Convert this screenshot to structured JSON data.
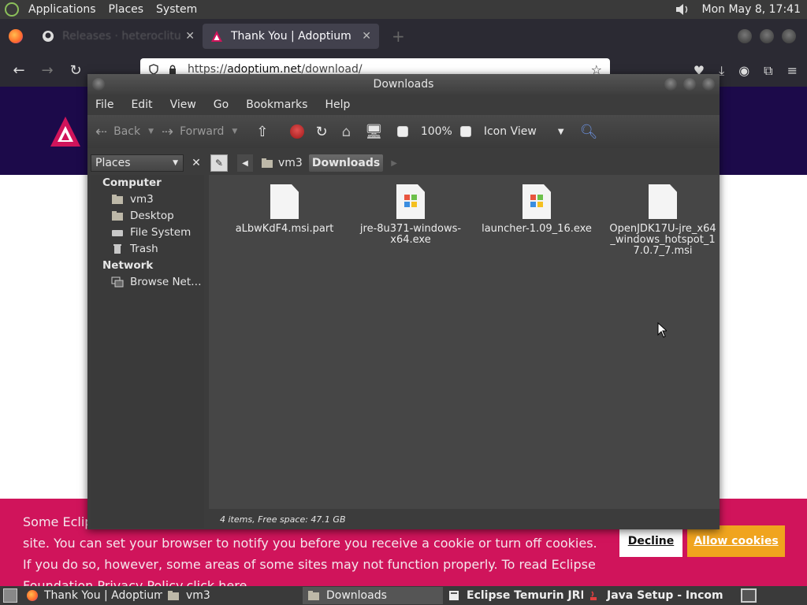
{
  "top_panel": {
    "menus": [
      "Applications",
      "Places",
      "System"
    ],
    "clock": "Mon May  8, 17:41"
  },
  "firefox": {
    "tabs": [
      {
        "label": "Releases · heteroclitus/..",
        "active": false
      },
      {
        "label": "Thank You | Adoptium",
        "active": true
      }
    ],
    "url_prefix": "https://",
    "url_domain": "adoptium.net",
    "url_path": "/download/"
  },
  "page": {
    "cookie_text": "Some Eclipse Foundation pages use cookies to better serve you when you return to the site. You can set your browser to notify you before you receive a cookie or turn off cookies. If you do so, however, some areas of some sites may not function properly. To read Eclipse Foundation Privacy Policy",
    "cookie_link": "click here.",
    "decline": "Decline",
    "allow": "Allow cookies"
  },
  "nautilus": {
    "title": "Downloads",
    "menu": [
      "File",
      "Edit",
      "View",
      "Go",
      "Bookmarks",
      "Help"
    ],
    "toolbar": {
      "back": "Back",
      "forward": "Forward",
      "zoom": "100%",
      "view": "Icon View"
    },
    "sidebar_header": "Places",
    "sidebar": {
      "computer": "Computer",
      "items": [
        "vm3",
        "Desktop",
        "File System",
        "Trash"
      ],
      "network": "Network",
      "network_items": [
        "Browse Net…"
      ]
    },
    "path": [
      "vm3",
      "Downloads"
    ],
    "files": [
      {
        "name": "aLbwKdF4.msi.part",
        "type": "doc"
      },
      {
        "name": "jre-8u371-windows-x64.exe",
        "type": "exe"
      },
      {
        "name": "launcher-1.09_16.exe",
        "type": "exe"
      },
      {
        "name": "OpenJDK17U-jre_x64_windows_hotspot_17.0.7_7.msi",
        "type": "doc"
      }
    ],
    "status": "4 items, Free space: 47.1 GB"
  },
  "taskbar": {
    "items": [
      {
        "label": "Thank You | Adoptium ...",
        "active": false,
        "bold": false
      },
      {
        "label": "vm3",
        "active": false,
        "bold": false
      },
      {
        "label": "Downloads",
        "active": true,
        "bold": false
      },
      {
        "label": "Eclipse Temurin JRE...",
        "active": false,
        "bold": true
      },
      {
        "label": "Java Setup - Incompl...",
        "active": false,
        "bold": true
      }
    ]
  },
  "colors": {
    "site_header": "#1c0a4a",
    "cookie_bg": "#d0145b",
    "allow_btn": "#f0a41e"
  }
}
